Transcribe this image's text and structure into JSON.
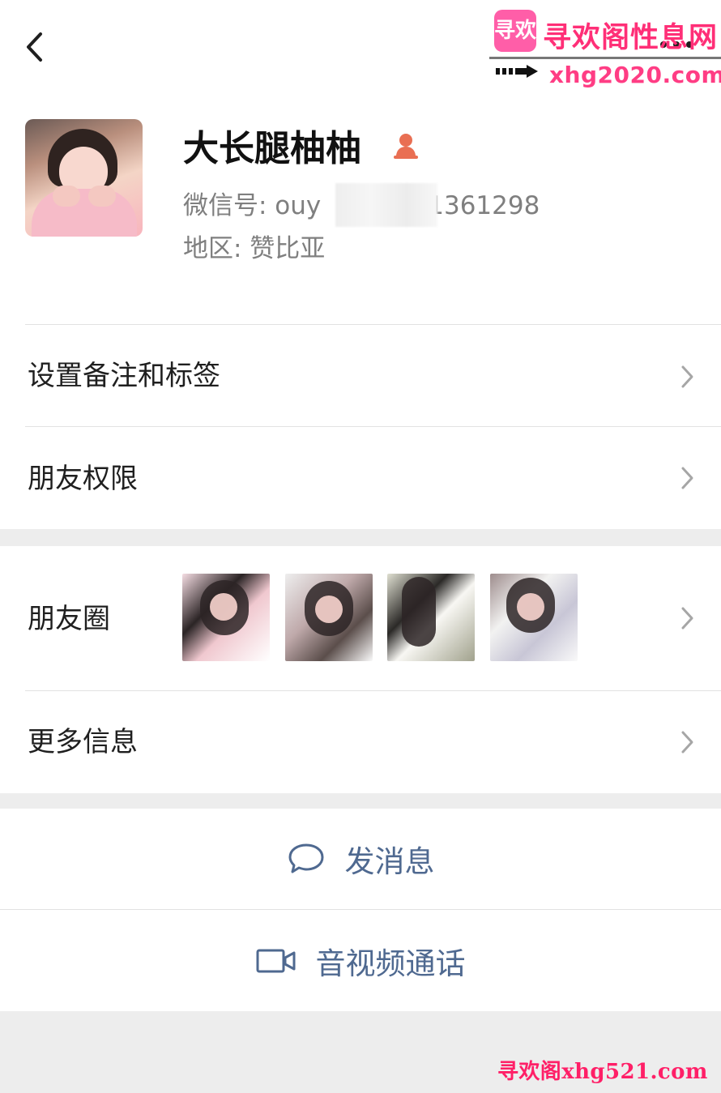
{
  "watermark": {
    "logo_text": "寻欢",
    "site_name": "寻欢阁性息网",
    "top_url": "xhg2020.com",
    "bottom_text": "寻欢阁xhg521.com"
  },
  "profile": {
    "nickname": "大长腿柚柚",
    "wechat_prefix": "微信号: ouy",
    "wechat_suffix": "1361298",
    "region": "地区: 赞比亚"
  },
  "menu": {
    "remark_tags": "设置备注和标签",
    "friend_permissions": "朋友权限",
    "moments": "朋友圈",
    "more_info": "更多信息"
  },
  "actions": {
    "send_message": "发消息",
    "video_call": "音视频通话"
  },
  "icons": {
    "back": "chevron-left-icon",
    "more": "more-icon",
    "gender": "female-icon",
    "message": "chat-bubble-icon",
    "video": "video-camera-icon",
    "chevron": "chevron-right-icon"
  },
  "colors": {
    "accent": "#4f6990",
    "divider": "#e2e2e2",
    "watermark": "#ff2f77",
    "gender_icon": "#e96f53"
  }
}
